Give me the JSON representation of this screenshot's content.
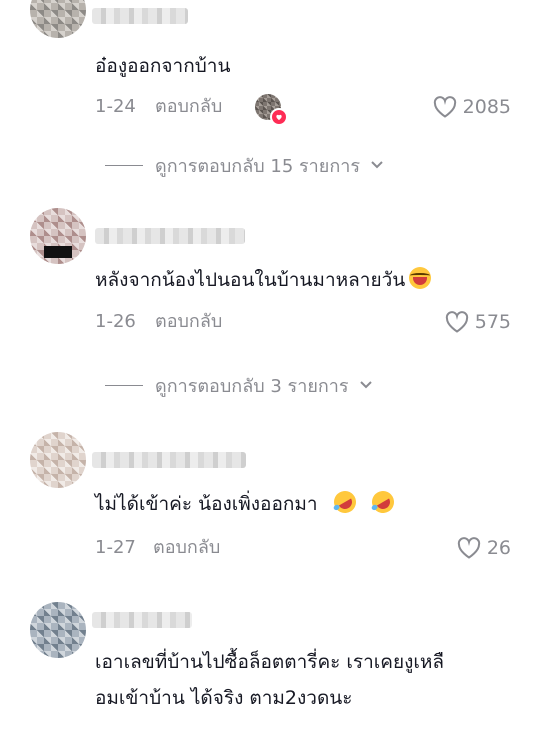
{
  "comments": [
    {
      "text": "อ๋องูออกจากบ้าน",
      "date": "1-24",
      "reply_label": "ตอบกลับ",
      "likes": "2085",
      "has_creator_like": true,
      "view_replies": "ดูการตอบกลับ 15 รายการ"
    },
    {
      "text": "หลังจากน้องไปนอนในบ้านมาหลายวัน",
      "emoji": "laughing-face",
      "date": "1-26",
      "reply_label": "ตอบกลับ",
      "likes": "575",
      "view_replies": "ดูการตอบกลับ 3 รายการ"
    },
    {
      "text": "ไม่ได้เข้าค่ะ น้องเพิ่งออกมา",
      "emoji": "rolling-on-floor-laughing",
      "date": "1-27",
      "reply_label": "ตอบกลับ",
      "likes": "26"
    },
    {
      "text_line1": "เอาเลขที่บ้านไปซื้อล็อตตารี่คะ เราเคยงูเหลื",
      "text_line2": "อมเข้าบ้าน ได้จริง ตาม2งวดนะ"
    }
  ],
  "colors": {
    "text": "#161823",
    "secondary": "#8a8b91",
    "creator_heart": "#fe2c55"
  }
}
